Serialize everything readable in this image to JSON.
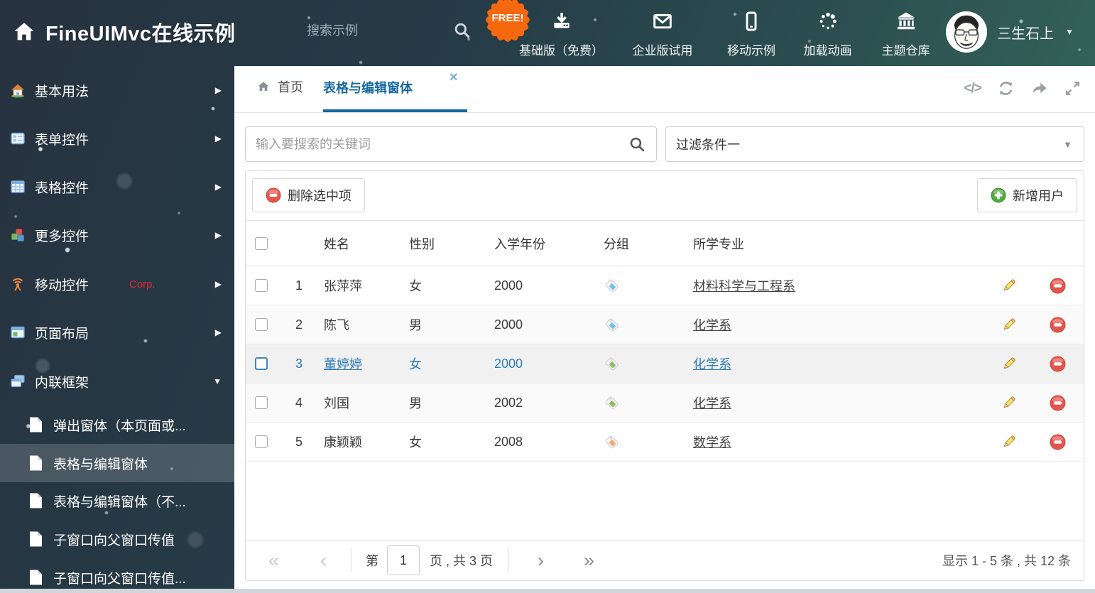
{
  "glyphs": {
    "caret_down": "▼",
    "close_tab": "×",
    "code_icon": "</>",
    "first_page": "«",
    "prev_page": "‹",
    "next_page": "›",
    "last_page": "»",
    "collapse_arrow": "▶",
    "expand_arrow": "▼"
  },
  "header": {
    "title": "FineUIMvc在线示例",
    "search_placeholder": "搜索示例",
    "free_badge": "FREE!",
    "nav": [
      {
        "label": "基础版（免费）",
        "icon": "download-icon"
      },
      {
        "label": "企业版试用",
        "icon": "envelope-icon"
      },
      {
        "label": "移动示例",
        "icon": "mobile-icon"
      },
      {
        "label": "加载动画",
        "icon": "spinner-icon"
      },
      {
        "label": "主题仓库",
        "icon": "bank-icon"
      }
    ],
    "user_name": "三生石上"
  },
  "sidebar": {
    "items": [
      {
        "label": "基本用法",
        "icon": "home-icon"
      },
      {
        "label": "表单控件",
        "icon": "form-icon"
      },
      {
        "label": "表格控件",
        "icon": "table-icon"
      },
      {
        "label": "更多控件",
        "icon": "cubes-icon"
      },
      {
        "label": "移动控件",
        "badge": "Corp.",
        "icon": "signal-icon"
      },
      {
        "label": "页面布局",
        "icon": "layout-icon"
      },
      {
        "label": "内联框架",
        "icon": "frames-icon"
      }
    ],
    "subitems": [
      {
        "label": "弹出窗体（本页面或..."
      },
      {
        "label": "表格与编辑窗体"
      },
      {
        "label": "表格与编辑窗体（不..."
      },
      {
        "label": "子窗口向父窗口传值"
      },
      {
        "label": "子窗口向父窗口传值..."
      }
    ]
  },
  "tabs": {
    "home": "首页",
    "active": "表格与编辑窗体"
  },
  "filters": {
    "search_placeholder": "输入要搜索的关键词",
    "filter_value": "过滤条件一"
  },
  "grid": {
    "toolbar": {
      "delete_label": "删除选中项",
      "add_label": "新增用户"
    },
    "columns": {
      "name": "姓名",
      "gender": "性别",
      "year": "入学年份",
      "group": "分组",
      "major": "所学专业"
    },
    "rows": [
      {
        "index": "1",
        "name": "张萍萍",
        "gender": "女",
        "year": "2000",
        "tag_color": "#72c2f1",
        "major": "材料科学与工程系"
      },
      {
        "index": "2",
        "name": "陈飞",
        "gender": "男",
        "year": "2000",
        "tag_color": "#72c2f1",
        "major": "化学系"
      },
      {
        "index": "3",
        "name": "董婷婷",
        "gender": "女",
        "year": "2000",
        "tag_color": "#8abf63",
        "major": "化学系"
      },
      {
        "index": "4",
        "name": "刘国",
        "gender": "男",
        "year": "2002",
        "tag_color": "#8abf63",
        "major": "化学系"
      },
      {
        "index": "5",
        "name": "康颖颖",
        "gender": "女",
        "year": "2008",
        "tag_color": "#f6ab63",
        "major": "数学系"
      }
    ]
  },
  "pagination": {
    "page_prefix": "第",
    "page_value": "1",
    "page_suffix": "页 , 共 3 页",
    "summary": "显示 1 - 5 条 , 共 12 条"
  },
  "colors": {
    "accent_blue": "#17689e",
    "selected_text": "#2e7cb9",
    "free_orange": "#f6680d",
    "delete_red": "#e4564c",
    "add_green": "#55a944"
  }
}
